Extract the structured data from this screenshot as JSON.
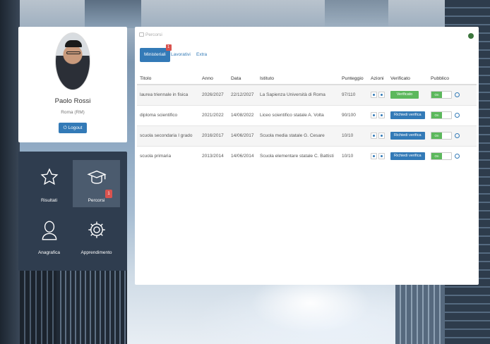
{
  "profile": {
    "name": "Paolo Rossi",
    "city": "Roma (RM)",
    "logout_label": "Logout"
  },
  "tiles": [
    {
      "label": "Risultati",
      "icon": "star-icon"
    },
    {
      "label": "Percorsi",
      "icon": "graduation-cap-icon",
      "badge": "1"
    },
    {
      "label": "Anagrafica",
      "icon": "user-icon"
    },
    {
      "label": "Apprendimento",
      "icon": "gear-icon"
    }
  ],
  "main": {
    "breadcrumb": "Percorsi",
    "tabs": [
      {
        "label": "Ministeriali",
        "badge": "1"
      },
      {
        "label": "Lavorativi"
      },
      {
        "label": "Extra"
      }
    ],
    "columns": [
      "Titolo",
      "Anno",
      "Data",
      "Istituto",
      "Punteggio",
      "Azioni",
      "Verificato",
      "Pubblico"
    ],
    "rows": [
      {
        "titolo": "laurea triennale in fisica",
        "anno": "2026/2027",
        "data": "22/12/2027",
        "istituto": "La Sapienza Università di Roma",
        "punteggio": "97/110",
        "verificato": "Verificato",
        "verified": true,
        "pubblico": "On"
      },
      {
        "titolo": "diploma scientifico",
        "anno": "2021/2022",
        "data": "14/08/2022",
        "istituto": "Liceo scientifico statale A. Volta",
        "punteggio": "90/100",
        "verificato": "Richiedi verifica",
        "verified": false,
        "pubblico": "On"
      },
      {
        "titolo": "scuola secondaria I grado",
        "anno": "2016/2017",
        "data": "14/06/2017",
        "istituto": "Scuola media statale G. Cesare",
        "punteggio": "10/10",
        "verificato": "Richiedi verifica",
        "verified": false,
        "pubblico": "On"
      },
      {
        "titolo": "scuola primaria",
        "anno": "2013/2014",
        "data": "14/06/2014",
        "istituto": "Scuola elementare statale C. Battisti",
        "punteggio": "10/10",
        "verificato": "Richiedi verifica",
        "verified": false,
        "pubblico": "On"
      }
    ]
  },
  "colors": {
    "primary": "#337ab7",
    "success": "#5cb85c",
    "danger": "#d9534f",
    "tile_bg": "#2f3d4f"
  }
}
